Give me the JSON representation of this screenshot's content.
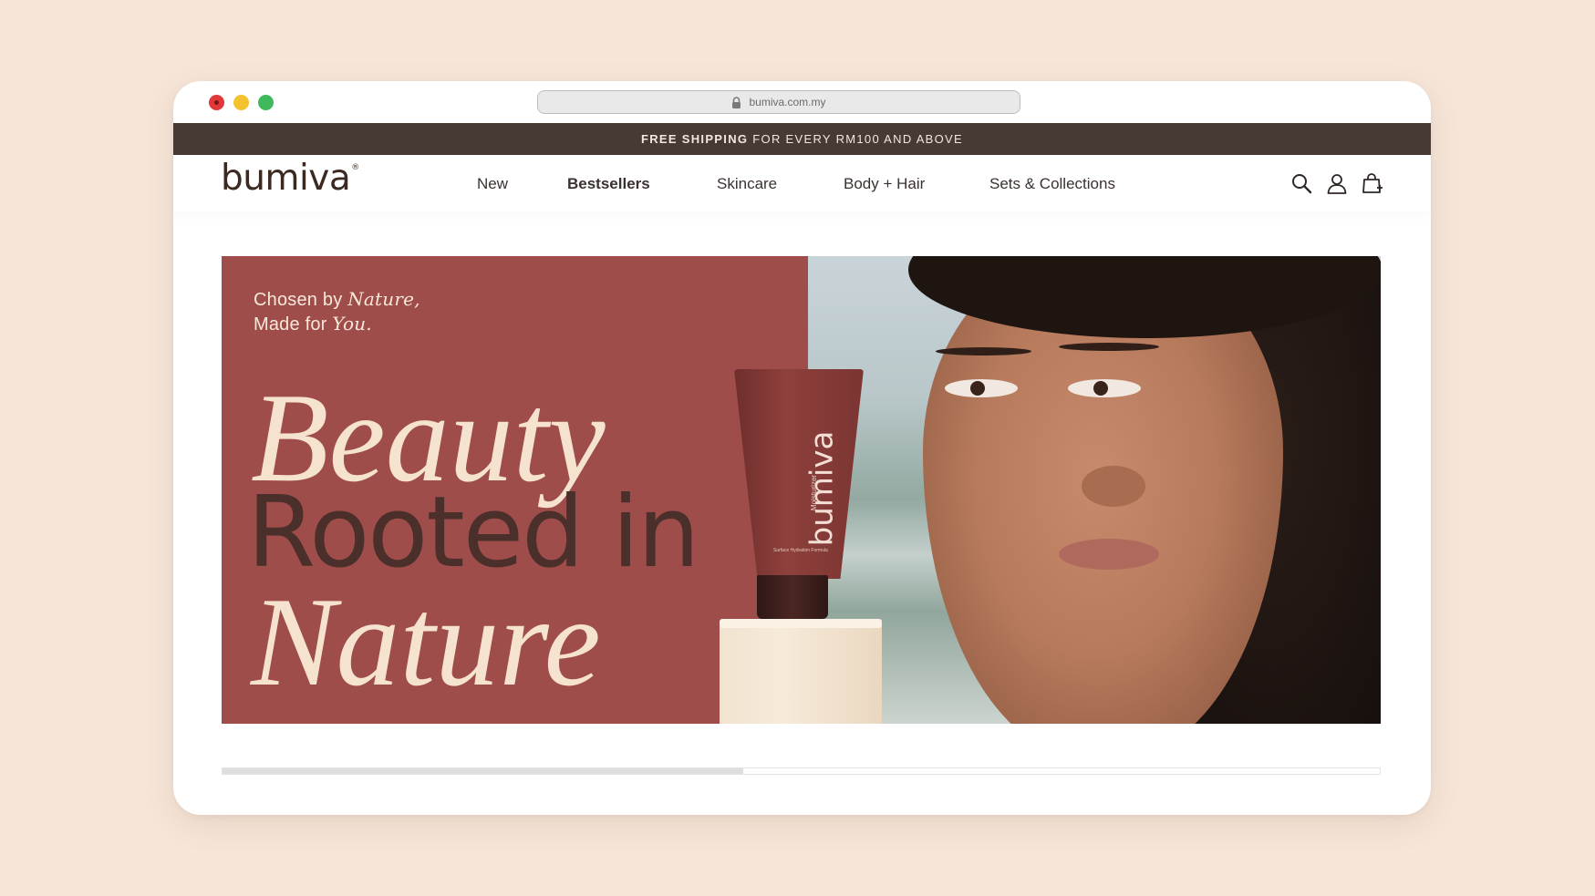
{
  "browser": {
    "url": "bumiva.com.my"
  },
  "promo": {
    "bold": "FREE SHIPPING",
    "rest": "FOR EVERY RM100 AND ABOVE"
  },
  "nav": {
    "logo": "bumiva",
    "logo_mark": "®",
    "items": [
      {
        "label": "New"
      },
      {
        "label": "Bestsellers"
      },
      {
        "label": "Skincare"
      },
      {
        "label": "Body + Hair"
      },
      {
        "label": "Sets & Collections"
      }
    ],
    "icons": [
      "search-icon",
      "account-icon",
      "cart-icon"
    ]
  },
  "hero": {
    "tagline_line1_prefix": "Chosen by",
    "tagline_line1_em": "Nature,",
    "tagline_line2_prefix": "Made for",
    "tagline_line2_em": "You.",
    "headline_line1": "Beauty",
    "headline_line2": "Rooted in",
    "headline_line3": "Nature",
    "product_brand": "bumiva",
    "product_type": "Moisturizer",
    "product_note": "Surface Hydration Formula"
  },
  "carousel": {
    "progress": 0.45
  },
  "colors": {
    "page_bg": "#f6e6d8",
    "promo_bar": "#473a33",
    "hero_panel": "#9f4d4b",
    "headline_light": "#f6e3cf",
    "headline_dark": "#4a2f2a"
  }
}
